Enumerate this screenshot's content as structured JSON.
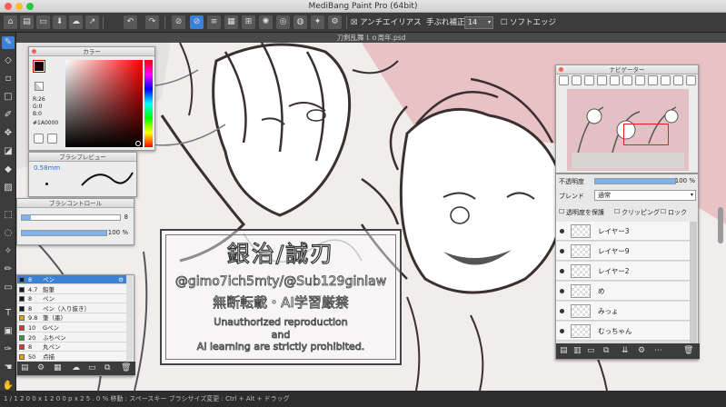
{
  "window": {
    "title": "MediBang Paint Pro (64bit)"
  },
  "document_tab": {
    "title": "刀剣乱舞ｌｏ周年.psd"
  },
  "toolbar": {
    "antialias_label": "アンチエイリアス",
    "stabilizer_label": "手ぶれ補正",
    "stabilizer_value": "14",
    "soft_edge_label": "ソフトエッジ"
  },
  "color_panel": {
    "title": "カラー",
    "r": "R:26",
    "g": "G:0",
    "b": "B:0",
    "hex": "#1A0000",
    "current_color": "#1A0000"
  },
  "brush_preview": {
    "title": "ブラシプレビュー",
    "size": "0.58mm"
  },
  "brush_control": {
    "title": "ブラシコントロール",
    "size_value": "8",
    "opacity_value": "100 %",
    "size_fill": 0.09,
    "opacity_fill": 1.0
  },
  "brush_list": [
    {
      "size": "8",
      "name": "ペン",
      "color": "#1a1a1a",
      "selected": true
    },
    {
      "size": "4.7",
      "name": "鉛筆",
      "color": "#1a1a1a",
      "selected": false
    },
    {
      "size": "8",
      "name": "ペン",
      "color": "#1a1a1a",
      "selected": false
    },
    {
      "size": "8",
      "name": "ペン（入り抜き）",
      "color": "#1a1a1a",
      "selected": false
    },
    {
      "size": "9.8",
      "name": "筆（墨）",
      "color": "#e8a000",
      "selected": false
    },
    {
      "size": "10",
      "name": "Gペン",
      "color": "#d23a2a",
      "selected": false
    },
    {
      "size": "20",
      "name": "ふちペン",
      "color": "#3a9a3a",
      "selected": false
    },
    {
      "size": "8",
      "name": "丸ペン",
      "color": "#d23a2a",
      "selected": false
    },
    {
      "size": "50",
      "name": "点描",
      "color": "#e8a000",
      "selected": false
    }
  ],
  "navigator": {
    "title": "ナビゲーター"
  },
  "layers_panel": {
    "opacity_label": "不透明度",
    "opacity_value": "100 %",
    "blend_label": "ブレンド",
    "blend_value": "通常",
    "protect_alpha": "透明度を保護",
    "clipping": "クリッピング",
    "lock": "ロック",
    "layers": [
      {
        "name": "レイヤー3",
        "selected": false
      },
      {
        "name": "レイヤー9",
        "selected": false
      },
      {
        "name": "レイヤー2",
        "selected": false
      },
      {
        "name": "め",
        "selected": false
      },
      {
        "name": "みっょ",
        "selected": false
      },
      {
        "name": "むっちゃん",
        "selected": false
      }
    ]
  },
  "watermark": {
    "title": "銀治/誠刃",
    "handles": "@gimo7ich5mty/@Sub129ginlaw",
    "notice_jp": "無断転載・AI学習厳禁",
    "notice_en_1": "Unauthorized reproduction",
    "notice_en_2": "and",
    "notice_en_3": "AI learning are strictly prohibited."
  },
  "statusbar": {
    "text": "1 / 1 2 0 0 x 1 2 0 0 p x   2 5 . 0 %   移動 : スペースキー   ブラシサイズ変更 : Ctrl + Alt + ドラッグ"
  }
}
